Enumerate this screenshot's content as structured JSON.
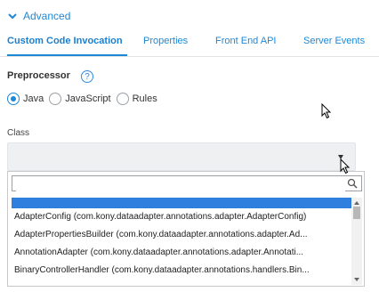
{
  "section": {
    "title": "Advanced"
  },
  "tabs": [
    {
      "label": "Custom Code Invocation"
    },
    {
      "label": "Properties"
    },
    {
      "label": "Front End API"
    },
    {
      "label": "Server Events"
    }
  ],
  "preprocessor": {
    "label": "Preprocessor",
    "help": "?",
    "options": [
      {
        "label": "Java",
        "selected": true
      },
      {
        "label": "JavaScript",
        "selected": false
      },
      {
        "label": "Rules",
        "selected": false
      }
    ]
  },
  "class_field": {
    "label": "Class",
    "value": "",
    "dropdown": {
      "search_value": "",
      "items": [
        {
          "label": ""
        },
        {
          "label": "AdapterConfig (com.kony.dataadapter.annotations.adapter.AdapterConfig)"
        },
        {
          "label": "AdapterPropertiesBuilder (com.kony.dataadapter.annotations.adapter.Ad..."
        },
        {
          "label": "AnnotationAdapter (com.kony.dataadapter.annotations.adapter.Annotati..."
        },
        {
          "label": "BinaryControllerHandler (com.kony.dataadapter.annotations.handlers.Bin..."
        }
      ]
    }
  },
  "colors": {
    "accent": "#1e88d5",
    "highlight": "#2f80de"
  }
}
